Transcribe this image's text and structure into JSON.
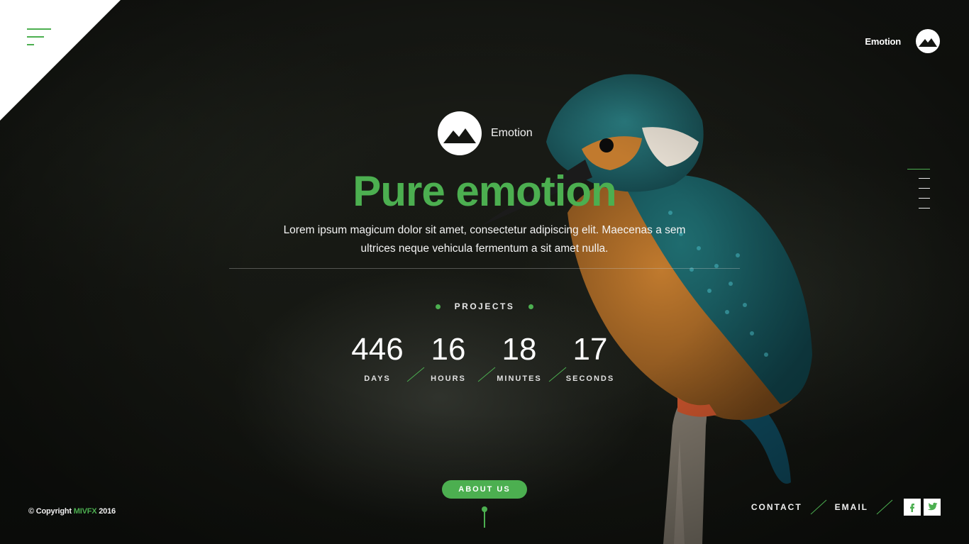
{
  "brand": {
    "name": "Emotion"
  },
  "hero": {
    "logo_text": "Emotion",
    "headline_light": "Pure",
    "headline_bold": "emotion",
    "lead": "Lorem ipsum magicum dolor sit amet, consectetur adipiscing elit. Maecenas a sem ultrices neque vehicula fermentum a sit amet nulla."
  },
  "projects": {
    "label": "PROJECTS"
  },
  "countdown": [
    {
      "value": "446",
      "unit": "DAYS"
    },
    {
      "value": "16",
      "unit": "HOURS"
    },
    {
      "value": "18",
      "unit": "MINUTES"
    },
    {
      "value": "17",
      "unit": "SECONDS"
    }
  ],
  "about": {
    "label": "ABOUT US"
  },
  "footer": {
    "copyright_prefix": "© Copyright",
    "copyright_brand": "MIVFX",
    "copyright_year": "2016",
    "links": [
      "CONTACT",
      "EMAIL"
    ],
    "social": [
      "facebook-icon",
      "twitter-icon"
    ]
  },
  "colors": {
    "accent": "#4caf50",
    "text": "#ffffff",
    "background": "#161813"
  }
}
